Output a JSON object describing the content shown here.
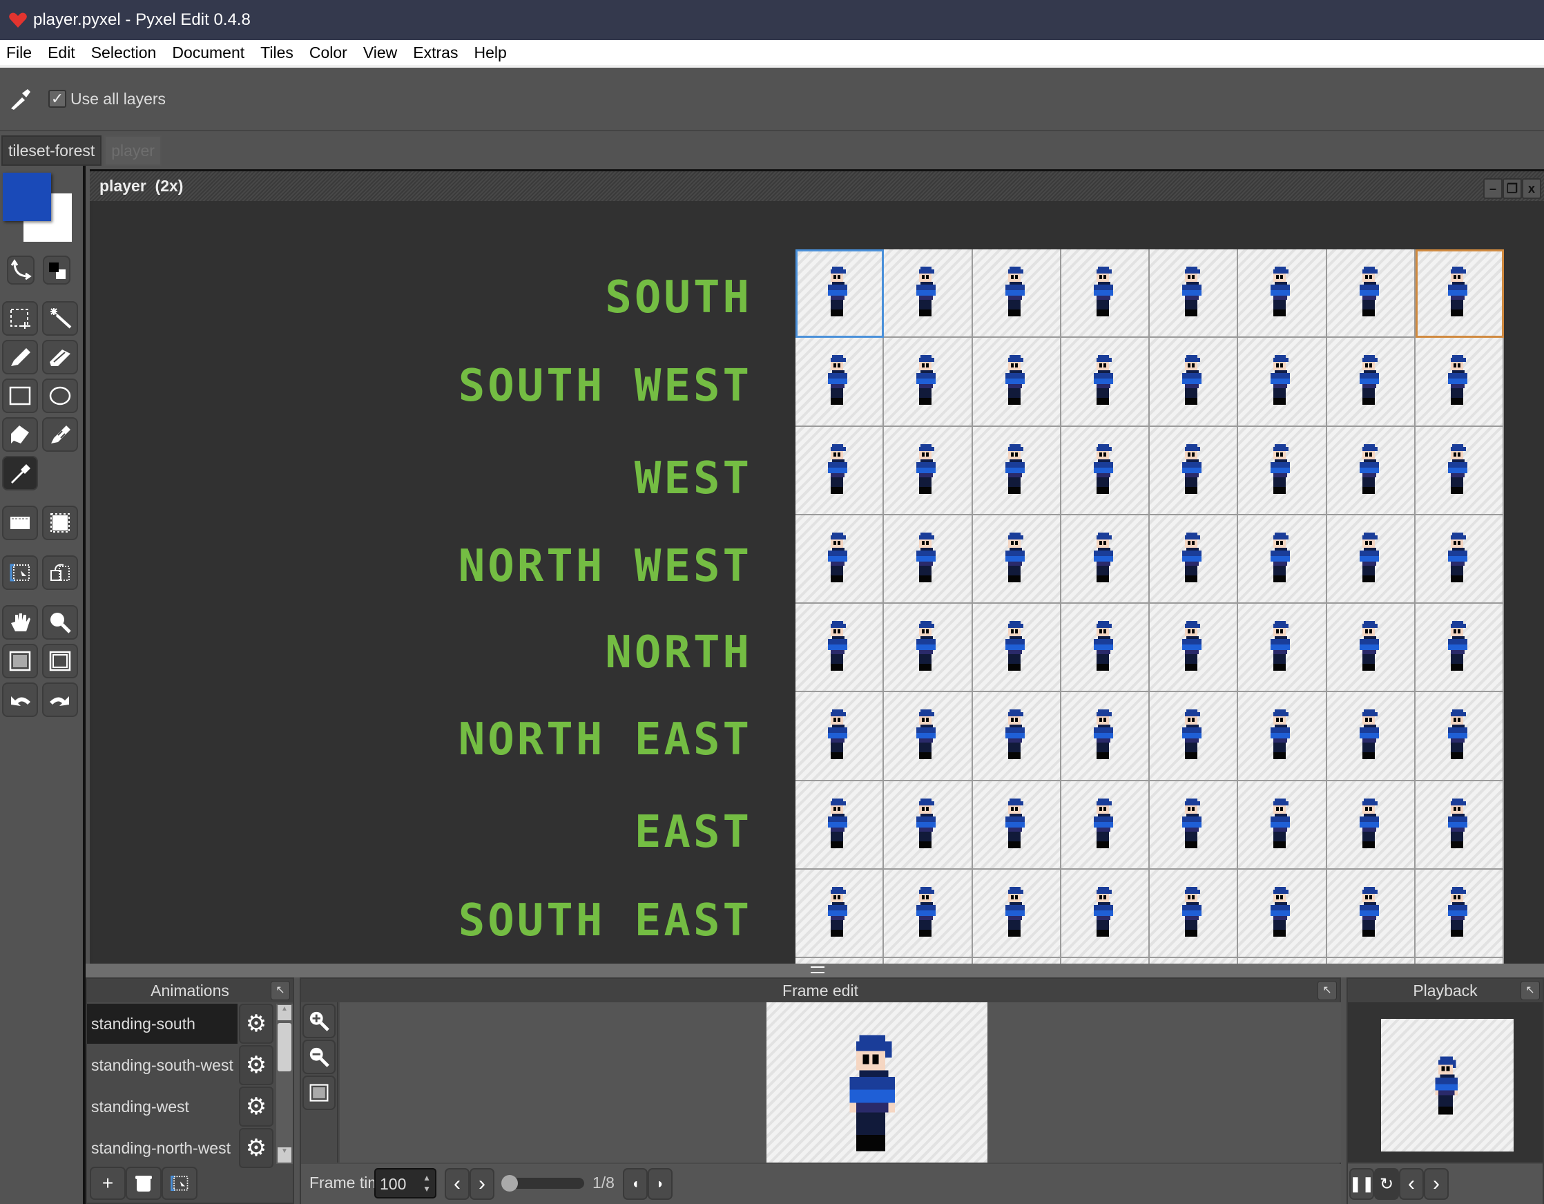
{
  "window": {
    "title": "player.pyxel - Pyxel Edit 0.4.8",
    "app_icon": "heart-icon"
  },
  "menu": {
    "items": [
      "File",
      "Edit",
      "Selection",
      "Document",
      "Tiles",
      "Color",
      "View",
      "Extras",
      "Help"
    ]
  },
  "tool_options": {
    "active_tool_icon": "eyedropper-icon",
    "use_all_layers_label": "Use all layers",
    "use_all_layers_checked": true
  },
  "tabs": [
    {
      "label": "tileset-forest",
      "active": true
    },
    {
      "label": "player",
      "active": false
    }
  ],
  "colors": {
    "primary": "#1a4ab8",
    "secondary": "#ffffff",
    "label_green": "#74bd43",
    "selection_start": "#4a90d9",
    "selection_end": "#d08a40"
  },
  "tools": [
    "swap-colors-icon",
    "default-colors-icon",
    "rect-select-icon",
    "magic-wand-icon",
    "pencil-icon",
    "eraser-icon",
    "rectangle-icon",
    "ellipse-icon",
    "fill-bucket-icon",
    "line-brush-icon",
    "eyedropper-icon",
    "tile-strip-icon",
    "resize-canvas-icon",
    "frame-select-icon",
    "tile-select-icon",
    "hand-pan-icon",
    "zoom-icon",
    "tile-grid-icon",
    "tile-frame-icon",
    "undo-icon",
    "redo-icon"
  ],
  "document": {
    "title": "player  (2x)",
    "window_buttons": {
      "minimize": "–",
      "restore": "❐",
      "close": "x"
    },
    "direction_labels": [
      "SOUTH",
      "SOUTH WEST",
      "WEST",
      "NORTH WEST",
      "NORTH",
      "NORTH EAST",
      "EAST",
      "SOUTH EAST"
    ],
    "grid": {
      "columns": 8,
      "rows_visible": 8
    }
  },
  "animations_panel": {
    "title": "Animations",
    "items": [
      "standing-south",
      "standing-south-west",
      "standing-west",
      "standing-north-west"
    ],
    "selected_index": 0,
    "buttons": [
      "add-icon",
      "delete-icon",
      "select-frames-icon"
    ]
  },
  "frame_edit_panel": {
    "title": "Frame edit",
    "frame_time_label": "Frame time",
    "frame_time_value": "100",
    "frame_counter": "1/8",
    "current_frame": 1,
    "total_frames": 8
  },
  "playback_panel": {
    "title": "Playback",
    "buttons": [
      "pause-icon",
      "loop-icon",
      "prev-icon",
      "next-icon"
    ]
  }
}
